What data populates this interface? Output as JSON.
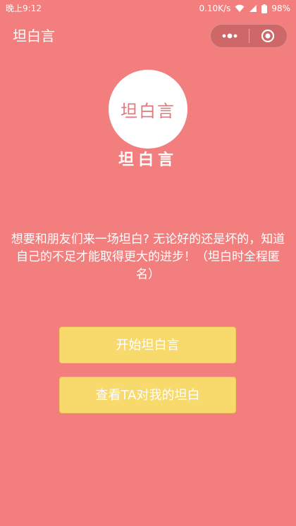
{
  "status_bar": {
    "time": "晚上9:12",
    "network_speed": "0.10K/s",
    "battery": "98%"
  },
  "navbar": {
    "title": "坦白言",
    "more_icon": "more-dots-icon",
    "close_icon": "target-close-icon"
  },
  "logo": {
    "text": "坦白言"
  },
  "app_name": "坦白言",
  "description": "想要和朋友们来一场坦白? 无论好的还是坏的，知道自己的不足才能取得更大的进步！（坦白时全程匿名）",
  "buttons": {
    "start": "开始坦白言",
    "view": "查看TA对我的坦白"
  },
  "colors": {
    "background": "#f27f7e",
    "button": "#f8d96b",
    "logo_text": "#e07a7c"
  }
}
